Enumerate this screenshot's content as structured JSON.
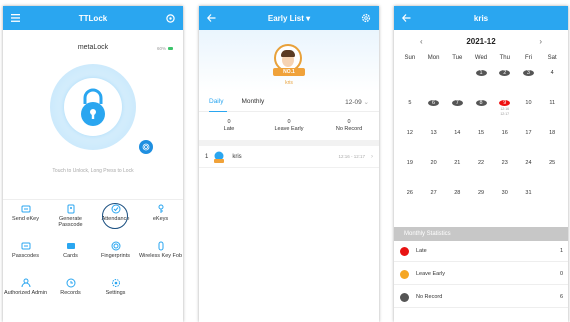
{
  "screen1": {
    "title": "TTLock",
    "lock_name": "metaLock",
    "battery": "60%",
    "hint": "Touch to Unlock, Long Press to Lock",
    "grid": [
      [
        {
          "label": "Send eKey",
          "icon": "key-send-icon"
        },
        {
          "label": "Generate Passcode",
          "icon": "passcode-icon"
        },
        {
          "label": "Attendance",
          "icon": "attendance-icon"
        },
        {
          "label": "eKeys",
          "icon": "ekeys-icon"
        }
      ],
      [
        {
          "label": "Passcodes",
          "icon": "passcodes-icon"
        },
        {
          "label": "Cards",
          "icon": "cards-icon"
        },
        {
          "label": "Fingerprints",
          "icon": "fingerprint-icon"
        },
        {
          "label": "Wireless Key Fob",
          "icon": "keyfob-icon"
        }
      ],
      [
        {
          "label": "Authorized Admin",
          "icon": "admin-icon"
        },
        {
          "label": "Records",
          "icon": "records-icon"
        },
        {
          "label": "Settings",
          "icon": "settings-icon"
        },
        {
          "label": "",
          "icon": ""
        }
      ]
    ]
  },
  "screen2": {
    "title": "Early List",
    "badge": "NO.1",
    "user": "kris",
    "tab_daily": "Daily",
    "tab_monthly": "Monthly",
    "date": "12-09",
    "stats": [
      {
        "value": "0",
        "label": "Late"
      },
      {
        "value": "0",
        "label": "Leave Early"
      },
      {
        "value": "0",
        "label": "No Record"
      }
    ],
    "record": {
      "rank": "1",
      "name": "kris",
      "time": "12:16 - 12:17"
    }
  },
  "screen3": {
    "title": "kris",
    "month": "2021-12",
    "weekdays": [
      "Sun",
      "Mon",
      "Tue",
      "Wed",
      "Thu",
      "Fri",
      "Sat"
    ],
    "rows": [
      [
        {
          "d": ""
        },
        {
          "d": ""
        },
        {
          "d": ""
        },
        {
          "d": "1",
          "s": "g"
        },
        {
          "d": "2",
          "s": "g"
        },
        {
          "d": "3",
          "s": "g"
        },
        {
          "d": "4"
        }
      ],
      [
        {
          "d": "5"
        },
        {
          "d": "6",
          "s": "g"
        },
        {
          "d": "7",
          "s": "g"
        },
        {
          "d": "8",
          "s": "g"
        },
        {
          "d": "9",
          "s": "r",
          "sub1": "12:16",
          "sub2": "12:17"
        },
        {
          "d": "10"
        },
        {
          "d": "11"
        }
      ],
      [
        {
          "d": "12"
        },
        {
          "d": "13"
        },
        {
          "d": "14"
        },
        {
          "d": "15"
        },
        {
          "d": "16"
        },
        {
          "d": "17"
        },
        {
          "d": "18"
        }
      ],
      [
        {
          "d": "19"
        },
        {
          "d": "20"
        },
        {
          "d": "21"
        },
        {
          "d": "22"
        },
        {
          "d": "23"
        },
        {
          "d": "24"
        },
        {
          "d": "25"
        }
      ],
      [
        {
          "d": "26"
        },
        {
          "d": "27"
        },
        {
          "d": "28"
        },
        {
          "d": "29"
        },
        {
          "d": "30"
        },
        {
          "d": "31"
        },
        {
          "d": ""
        }
      ]
    ],
    "monthly_stats": "Monthly Statistics",
    "legend": [
      {
        "label": "Late",
        "value": "1",
        "color": "#e81313"
      },
      {
        "label": "Leave Early",
        "value": "0",
        "color": "#f5a623"
      },
      {
        "label": "No Record",
        "value": "6",
        "color": "#555555"
      }
    ]
  },
  "colors": {
    "accent": "#2aa6f0"
  }
}
